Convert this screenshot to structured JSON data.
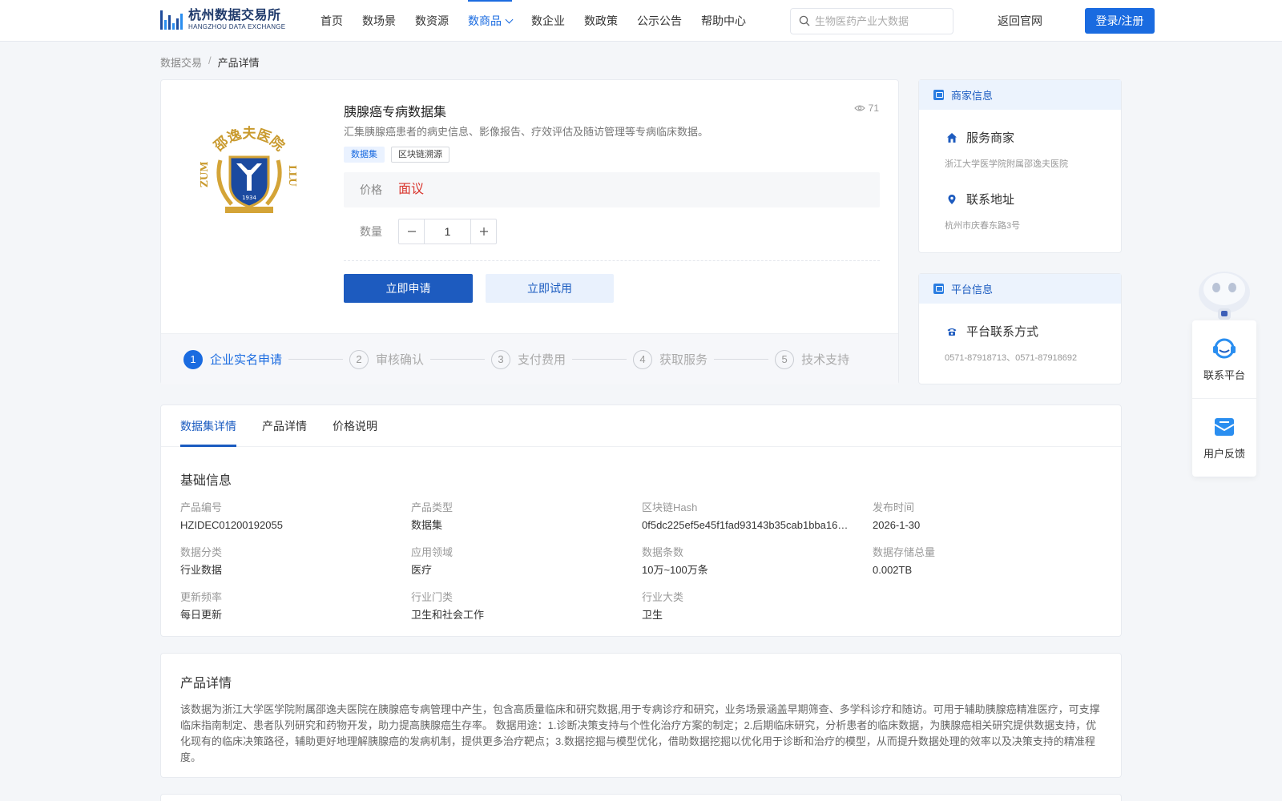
{
  "header": {
    "logo_cn": "杭州数据交易所",
    "logo_en": "HANGZHOU DATA EXCHANGE",
    "nav": [
      "首页",
      "数场景",
      "数资源",
      "数商品",
      "数企业",
      "数政策",
      "公示公告",
      "帮助中心"
    ],
    "active_nav": "数商品",
    "search_text": "生物医药产业大数据",
    "back_link": "返回官网",
    "login": "登录/注册"
  },
  "breadcrumb": {
    "root": "数据交易",
    "sep": "/",
    "current": "产品详情"
  },
  "product": {
    "title": "胰腺癌专病数据集",
    "views": "71",
    "description": "汇集胰腺癌患者的病史信息、影像报告、疗效评估及随访管理等专病临床数据。",
    "tags": [
      "数据集",
      "区块链溯源"
    ],
    "price_label": "价格",
    "price_value": "面议",
    "qty_label": "数量",
    "qty_value": "1",
    "apply_button": "立即申请",
    "trial_button": "立即试用",
    "logo_ring_text": "邵逸夫医院",
    "logo_year": "1934",
    "logo_side_left": "ZUM",
    "logo_side_right": "LLU",
    "steps": [
      {
        "num": "1",
        "label": "企业实名申请"
      },
      {
        "num": "2",
        "label": "审核确认"
      },
      {
        "num": "3",
        "label": "支付费用"
      },
      {
        "num": "4",
        "label": "获取服务"
      },
      {
        "num": "5",
        "label": "技术支持"
      }
    ]
  },
  "merchant": {
    "header": "商家信息",
    "service_title": "服务商家",
    "service_value": "浙江大学医学院附属邵逸夫医院",
    "address_title": "联系地址",
    "address_value": "杭州市庆春东路3号"
  },
  "platform": {
    "header": "平台信息",
    "contact_title": "平台联系方式",
    "contact_value": "0571-87918713、0571-87918692"
  },
  "float": {
    "contact": "联系平台",
    "feedback": "用户反馈"
  },
  "tabs": [
    "数据集详情",
    "产品详情",
    "价格说明"
  ],
  "basic_info": {
    "title": "基础信息",
    "fields": [
      {
        "label": "产品编号",
        "value": "HZIDEC01200192055"
      },
      {
        "label": "产品类型",
        "value": "数据集"
      },
      {
        "label": "区块链Hash",
        "value": "0f5dc225ef5e45f1fad93143b35cab1bba16…"
      },
      {
        "label": "发布时间",
        "value": "2026-1-30"
      },
      {
        "label": "数据分类",
        "value": "行业数据"
      },
      {
        "label": "应用领域",
        "value": "医疗"
      },
      {
        "label": "数据条数",
        "value": "10万~100万条"
      },
      {
        "label": "数据存储总量",
        "value": "0.002TB"
      },
      {
        "label": "更新频率",
        "value": "每日更新"
      },
      {
        "label": "行业门类",
        "value": "卫生和社会工作"
      },
      {
        "label": "行业大类",
        "value": "卫生"
      }
    ]
  },
  "product_detail": {
    "title": "产品详情",
    "text": "该数据为浙江大学医学院附属邵逸夫医院在胰腺癌专病管理中产生，包含高质量临床和研究数据,用于专病诊疗和研究，业务场景涵盖早期筛查、多学科诊疗和随访。可用于辅助胰腺癌精准医疗，可支撑临床指南制定、患者队列研究和药物开发，助力提高胰腺癌生存率。 数据用途：1.诊断决策支持与个性化治疗方案的制定；2.后期临床研究，分析患者的临床数据，为胰腺癌相关研究提供数据支持，优化现有的临床决策路径，辅助更好地理解胰腺癌的发病机制，提供更多治疗靶点；3.数据挖掘与模型优化，借助数据挖掘以优化用于诊断和治疗的模型，从而提升数据处理的效率以及决策支持的精准程度。"
  },
  "colors": {
    "primary": "#1a6be0",
    "price": "#d9362e",
    "accent_dark": "#1d5bbf"
  }
}
